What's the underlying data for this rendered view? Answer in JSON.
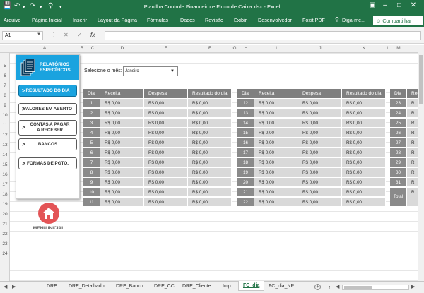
{
  "window": {
    "title": "Planilha Controle Financeiro e Fluxo de Caixa.xlsx - Excel"
  },
  "ribbon": {
    "tabs": [
      "Arquivo",
      "Página Inicial",
      "Inserir",
      "Layout da Página",
      "Fórmulas",
      "Dados",
      "Revisão",
      "Exibir",
      "Desenvolvedor",
      "Foxit PDF",
      "Diga-me..."
    ],
    "share": "Compartilhar"
  },
  "formula": {
    "namebox": "A1",
    "fx": "fx",
    "value": ""
  },
  "columns": [
    "A",
    "B",
    "C",
    "D",
    "E",
    "F",
    "G",
    "H",
    "I",
    "J",
    "K",
    "L",
    "M"
  ],
  "rows": [
    "5",
    "6",
    "7",
    "8",
    "9",
    "10",
    "11",
    "12",
    "13",
    "14",
    "15",
    "16",
    "17",
    "18",
    "19",
    "20",
    "21",
    "22",
    "23",
    "24"
  ],
  "panel": {
    "title": "RELATÓRIOS ESPECÍFICOS",
    "buttons": [
      {
        "label": "RESULTADO DO DIA"
      },
      {
        "label": "VALORES EM ABERTO"
      },
      {
        "label": "CONTAS A PAGAR\nA RECEBER"
      },
      {
        "label": "BANCOS"
      },
      {
        "label": "FORMAS DE PGTO."
      }
    ],
    "menu": "MENU INICIAL"
  },
  "month_select": {
    "label": "Selecione o mês:",
    "value": "Janeiro"
  },
  "table": {
    "headers": [
      "Dia",
      "Receita",
      "Despesa",
      "Resultado do dia"
    ],
    "empty_value": "R$ 0,00",
    "days1": [
      "1",
      "2",
      "3",
      "4",
      "5",
      "6",
      "7",
      "8",
      "9",
      "10",
      "11"
    ],
    "days2": [
      "12",
      "13",
      "14",
      "15",
      "16",
      "17",
      "18",
      "19",
      "20",
      "21",
      "22"
    ],
    "days3": [
      "23",
      "24",
      "25",
      "26",
      "27",
      "28",
      "29",
      "30",
      "31",
      "Total"
    ],
    "partial_cell": "R"
  },
  "sheets": [
    "DRE",
    "DRE_Detalhado",
    "DRE_Banco",
    "DRE_CC",
    "DRE_Cliente",
    "Imp",
    "FC_dia",
    "FC_dia_NP"
  ],
  "active_sheet": "FC_dia",
  "colors": {
    "excel_green": "#217346",
    "accent_blue": "#1aa3df",
    "home_red": "#e35456"
  }
}
